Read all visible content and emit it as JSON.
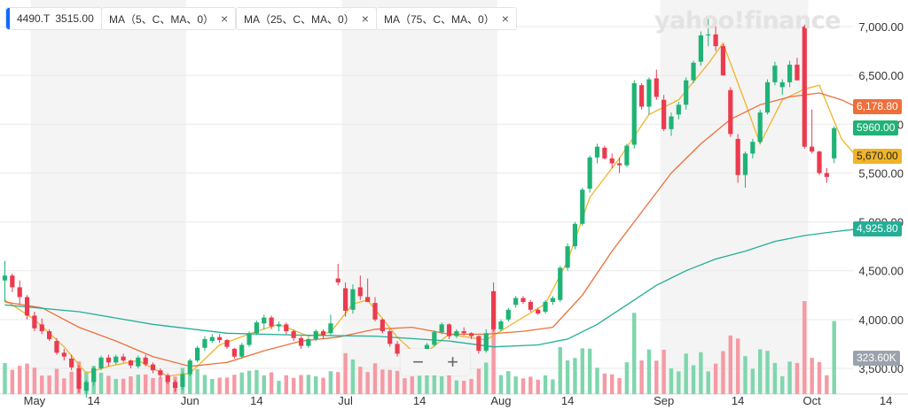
{
  "chips": [
    {
      "symbol": "4490.T",
      "value": "3515.00"
    },
    {
      "label": "MA（5、C、MA、0）"
    },
    {
      "label": "MA（25、C、MA、0）"
    },
    {
      "label": "MA（75、C、MA、0）"
    }
  ],
  "close_icon": "×",
  "logo": "yahoo!finance",
  "zoom": {
    "minus": "−",
    "plus": "+"
  },
  "price_tags": {
    "ma25": "6,178.80",
    "last": "5960.00",
    "ma5": "5,670.00",
    "ma75": "4,925.80",
    "volume": "323.60K"
  },
  "colors": {
    "up": "#1fb376",
    "down": "#eb3b4e",
    "ma5": "#f0b428",
    "ma25": "#ee6f3a",
    "ma75": "#24ae96",
    "band": "#f4f4f4",
    "grid": "#e9e9e9",
    "vol_up": "#7fd6ad",
    "vol_down": "#f59aa4",
    "last_tag": "#1fb376",
    "vol_tag": "#9aa3ad"
  },
  "chart_data": {
    "type": "candlestick",
    "ylim": [
      3300,
      7200
    ],
    "y_ticks": [
      3500,
      4000,
      4500,
      5000,
      5500,
      6000,
      6500,
      7000
    ],
    "y_tick_labels": [
      "3,500.00",
      "4,000.00",
      "4,500.00",
      "5,000.00",
      "5,500.00",
      "6,000.00",
      "6,500.00",
      "7,000.00"
    ],
    "x_labels": [
      {
        "label": "May",
        "i": 4
      },
      {
        "label": "14",
        "i": 12
      },
      {
        "label": "Jun",
        "i": 25
      },
      {
        "label": "14",
        "i": 34
      },
      {
        "label": "Jul",
        "i": 46
      },
      {
        "label": "14",
        "i": 56
      },
      {
        "label": "Aug",
        "i": 67
      },
      {
        "label": "14",
        "i": 76
      },
      {
        "label": "Sep",
        "i": 89
      },
      {
        "label": "14",
        "i": 99
      },
      {
        "label": "Oct",
        "i": 109
      },
      {
        "label": "14",
        "i": 119
      }
    ],
    "month_bands": [
      [
        4,
        25
      ],
      [
        46,
        67
      ],
      [
        89,
        109
      ]
    ],
    "ohlc": [
      [
        4400,
        4600,
        4180,
        4450
      ],
      [
        4450,
        4470,
        4280,
        4330
      ],
      [
        4330,
        4400,
        4150,
        4230
      ],
      [
        4230,
        4250,
        4000,
        4040
      ],
      [
        4040,
        4080,
        3880,
        3910
      ],
      [
        3950,
        4010,
        3850,
        3880
      ],
      [
        3880,
        3900,
        3780,
        3800
      ],
      [
        3780,
        3810,
        3640,
        3660
      ],
      [
        3660,
        3700,
        3580,
        3620
      ],
      [
        3600,
        3640,
        3480,
        3510
      ],
      [
        3500,
        3530,
        3250,
        3290
      ],
      [
        3270,
        3380,
        3200,
        3360
      ],
      [
        3360,
        3520,
        3320,
        3500
      ],
      [
        3500,
        3630,
        3480,
        3610
      ],
      [
        3610,
        3640,
        3520,
        3560
      ],
      [
        3560,
        3640,
        3540,
        3620
      ],
      [
        3620,
        3650,
        3560,
        3580
      ],
      [
        3580,
        3590,
        3500,
        3530
      ],
      [
        3520,
        3630,
        3500,
        3610
      ],
      [
        3610,
        3640,
        3520,
        3540
      ],
      [
        3540,
        3560,
        3450,
        3480
      ],
      [
        3480,
        3500,
        3400,
        3430
      ],
      [
        3430,
        3450,
        3340,
        3360
      ],
      [
        3360,
        3380,
        3260,
        3300
      ],
      [
        3310,
        3460,
        3280,
        3440
      ],
      [
        3440,
        3600,
        3420,
        3580
      ],
      [
        3580,
        3730,
        3560,
        3710
      ],
      [
        3710,
        3830,
        3680,
        3800
      ],
      [
        3780,
        3850,
        3760,
        3820
      ],
      [
        3820,
        3850,
        3760,
        3790
      ],
      [
        3790,
        3800,
        3700,
        3720
      ],
      [
        3700,
        3710,
        3600,
        3620
      ],
      [
        3620,
        3760,
        3600,
        3740
      ],
      [
        3740,
        3880,
        3720,
        3860
      ],
      [
        3860,
        3990,
        3840,
        3970
      ],
      [
        3960,
        4050,
        3900,
        4020
      ],
      [
        4020,
        4040,
        3900,
        3930
      ],
      [
        3930,
        3980,
        3880,
        3950
      ],
      [
        3950,
        3970,
        3850,
        3880
      ],
      [
        3880,
        3900,
        3780,
        3810
      ],
      [
        3810,
        3830,
        3700,
        3730
      ],
      [
        3730,
        3820,
        3710,
        3800
      ],
      [
        3800,
        3900,
        3780,
        3880
      ],
      [
        3880,
        3900,
        3800,
        3840
      ],
      [
        3860,
        4050,
        3840,
        3960
      ],
      [
        4420,
        4570,
        4350,
        4380
      ],
      [
        4320,
        4380,
        4030,
        4090
      ],
      [
        4100,
        4360,
        4060,
        4310
      ],
      [
        4330,
        4450,
        4200,
        4240
      ],
      [
        4230,
        4420,
        4180,
        4180
      ],
      [
        4170,
        4230,
        3980,
        4000
      ],
      [
        4000,
        4010,
        3860,
        3880
      ],
      [
        3880,
        3900,
        3720,
        3750
      ],
      [
        3750,
        3780,
        3620,
        3650
      ],
      [
        3650,
        3670,
        3560,
        3590
      ],
      [
        3590,
        3610,
        3500,
        3530
      ],
      [
        3530,
        3640,
        3500,
        3620
      ],
      [
        3620,
        3760,
        3600,
        3740
      ],
      [
        3740,
        3890,
        3720,
        3870
      ],
      [
        3870,
        3970,
        3850,
        3950
      ],
      [
        3950,
        3960,
        3800,
        3830
      ],
      [
        3830,
        3900,
        3810,
        3880
      ],
      [
        3880,
        3920,
        3840,
        3860
      ],
      [
        3860,
        3870,
        3800,
        3830
      ],
      [
        3830,
        3840,
        3650,
        3680
      ],
      [
        3680,
        3900,
        3660,
        3860
      ],
      [
        4290,
        4380,
        3880,
        3900
      ],
      [
        3900,
        4000,
        3880,
        3980
      ],
      [
        4000,
        4120,
        3980,
        4100
      ],
      [
        4150,
        4240,
        4120,
        4220
      ],
      [
        4220,
        4240,
        4160,
        4180
      ],
      [
        4180,
        4200,
        4080,
        4100
      ],
      [
        4100,
        4120,
        4050,
        4060
      ],
      [
        4080,
        4200,
        4060,
        4180
      ],
      [
        4180,
        4240,
        4150,
        4220
      ],
      [
        4200,
        4550,
        4180,
        4530
      ],
      [
        4530,
        4780,
        4500,
        4750
      ],
      [
        4750,
        5000,
        4720,
        4980
      ],
      [
        4980,
        5350,
        4960,
        5330
      ],
      [
        5340,
        5680,
        5300,
        5660
      ],
      [
        5660,
        5800,
        5600,
        5770
      ],
      [
        5760,
        5780,
        5640,
        5650
      ],
      [
        5650,
        5700,
        5550,
        5600
      ],
      [
        5600,
        5660,
        5500,
        5580
      ],
      [
        5580,
        5800,
        5560,
        5780
      ],
      [
        5790,
        6450,
        5750,
        6420
      ],
      [
        6400,
        6420,
        6150,
        6180
      ],
      [
        6180,
        6480,
        6100,
        6460
      ],
      [
        6470,
        6560,
        6250,
        6280
      ],
      [
        6250,
        6300,
        5930,
        5950
      ],
      [
        5950,
        6120,
        5880,
        6080
      ],
      [
        6100,
        6230,
        6050,
        6200
      ],
      [
        6200,
        6480,
        6150,
        6450
      ],
      [
        6450,
        6650,
        6420,
        6630
      ],
      [
        6640,
        6950,
        6600,
        6910
      ],
      [
        6910,
        7100,
        6800,
        6920
      ],
      [
        6920,
        7050,
        6750,
        6800
      ],
      [
        6800,
        6820,
        6500,
        6500
      ],
      [
        6350,
        6380,
        5870,
        5900
      ],
      [
        5850,
        5900,
        5400,
        5480
      ],
      [
        5480,
        5720,
        5350,
        5700
      ],
      [
        5700,
        5850,
        5650,
        5820
      ],
      [
        5820,
        6150,
        5800,
        6120
      ],
      [
        6120,
        6460,
        6100,
        6430
      ],
      [
        6430,
        6640,
        6400,
        6600
      ],
      [
        6380,
        6460,
        6300,
        6430
      ],
      [
        6430,
        6650,
        6380,
        6610
      ],
      [
        6610,
        6680,
        6450,
        6450
      ],
      [
        7000,
        7020,
        5750,
        5770
      ],
      [
        5770,
        6150,
        5700,
        5720
      ],
      [
        5720,
        5730,
        5480,
        5500
      ],
      [
        5500,
        5550,
        5400,
        5460
      ],
      [
        5650,
        5980,
        5600,
        5960
      ]
    ],
    "series": [
      {
        "name": "MA（5、C、MA、0）",
        "points": [
          [
            0,
            4200
          ],
          [
            4,
            4000
          ],
          [
            8,
            3720
          ],
          [
            11,
            3450
          ],
          [
            14,
            3520
          ],
          [
            18,
            3580
          ],
          [
            22,
            3420
          ],
          [
            25,
            3450
          ],
          [
            29,
            3740
          ],
          [
            34,
            3880
          ],
          [
            37,
            3950
          ],
          [
            41,
            3830
          ],
          [
            44,
            3870
          ],
          [
            47,
            4160
          ],
          [
            49,
            4200
          ],
          [
            53,
            3820
          ],
          [
            56,
            3610
          ],
          [
            60,
            3850
          ],
          [
            65,
            3790
          ],
          [
            68,
            3930
          ],
          [
            73,
            4160
          ],
          [
            76,
            4600
          ],
          [
            79,
            5250
          ],
          [
            83,
            5650
          ],
          [
            87,
            6100
          ],
          [
            91,
            6250
          ],
          [
            95,
            6620
          ],
          [
            97,
            6830
          ],
          [
            100,
            6220
          ],
          [
            102,
            5800
          ],
          [
            105,
            6250
          ],
          [
            108,
            6360
          ],
          [
            110,
            6400
          ],
          [
            113,
            5850
          ],
          [
            115,
            5670
          ]
        ]
      },
      {
        "name": "MA（25、C、MA、0）",
        "points": [
          [
            0,
            4180
          ],
          [
            5,
            4120
          ],
          [
            10,
            3920
          ],
          [
            15,
            3780
          ],
          [
            20,
            3620
          ],
          [
            25,
            3520
          ],
          [
            30,
            3560
          ],
          [
            35,
            3680
          ],
          [
            40,
            3780
          ],
          [
            45,
            3820
          ],
          [
            50,
            3900
          ],
          [
            55,
            3920
          ],
          [
            60,
            3850
          ],
          [
            65,
            3850
          ],
          [
            70,
            3880
          ],
          [
            74,
            3920
          ],
          [
            78,
            4250
          ],
          [
            82,
            4700
          ],
          [
            86,
            5100
          ],
          [
            90,
            5500
          ],
          [
            94,
            5800
          ],
          [
            98,
            6050
          ],
          [
            102,
            6200
          ],
          [
            106,
            6280
          ],
          [
            110,
            6320
          ],
          [
            113,
            6250
          ],
          [
            115,
            6178
          ]
        ]
      },
      {
        "name": "MA（75、C、MA、0）",
        "points": [
          [
            0,
            4150
          ],
          [
            10,
            4080
          ],
          [
            20,
            3950
          ],
          [
            30,
            3860
          ],
          [
            40,
            3840
          ],
          [
            50,
            3830
          ],
          [
            60,
            3780
          ],
          [
            66,
            3720
          ],
          [
            72,
            3740
          ],
          [
            76,
            3800
          ],
          [
            80,
            3950
          ],
          [
            84,
            4150
          ],
          [
            88,
            4350
          ],
          [
            92,
            4500
          ],
          [
            96,
            4620
          ],
          [
            100,
            4700
          ],
          [
            104,
            4800
          ],
          [
            108,
            4860
          ],
          [
            112,
            4900
          ],
          [
            115,
            4925
          ]
        ]
      }
    ],
    "volume_ylim": [
      0,
      2000
    ]
  }
}
